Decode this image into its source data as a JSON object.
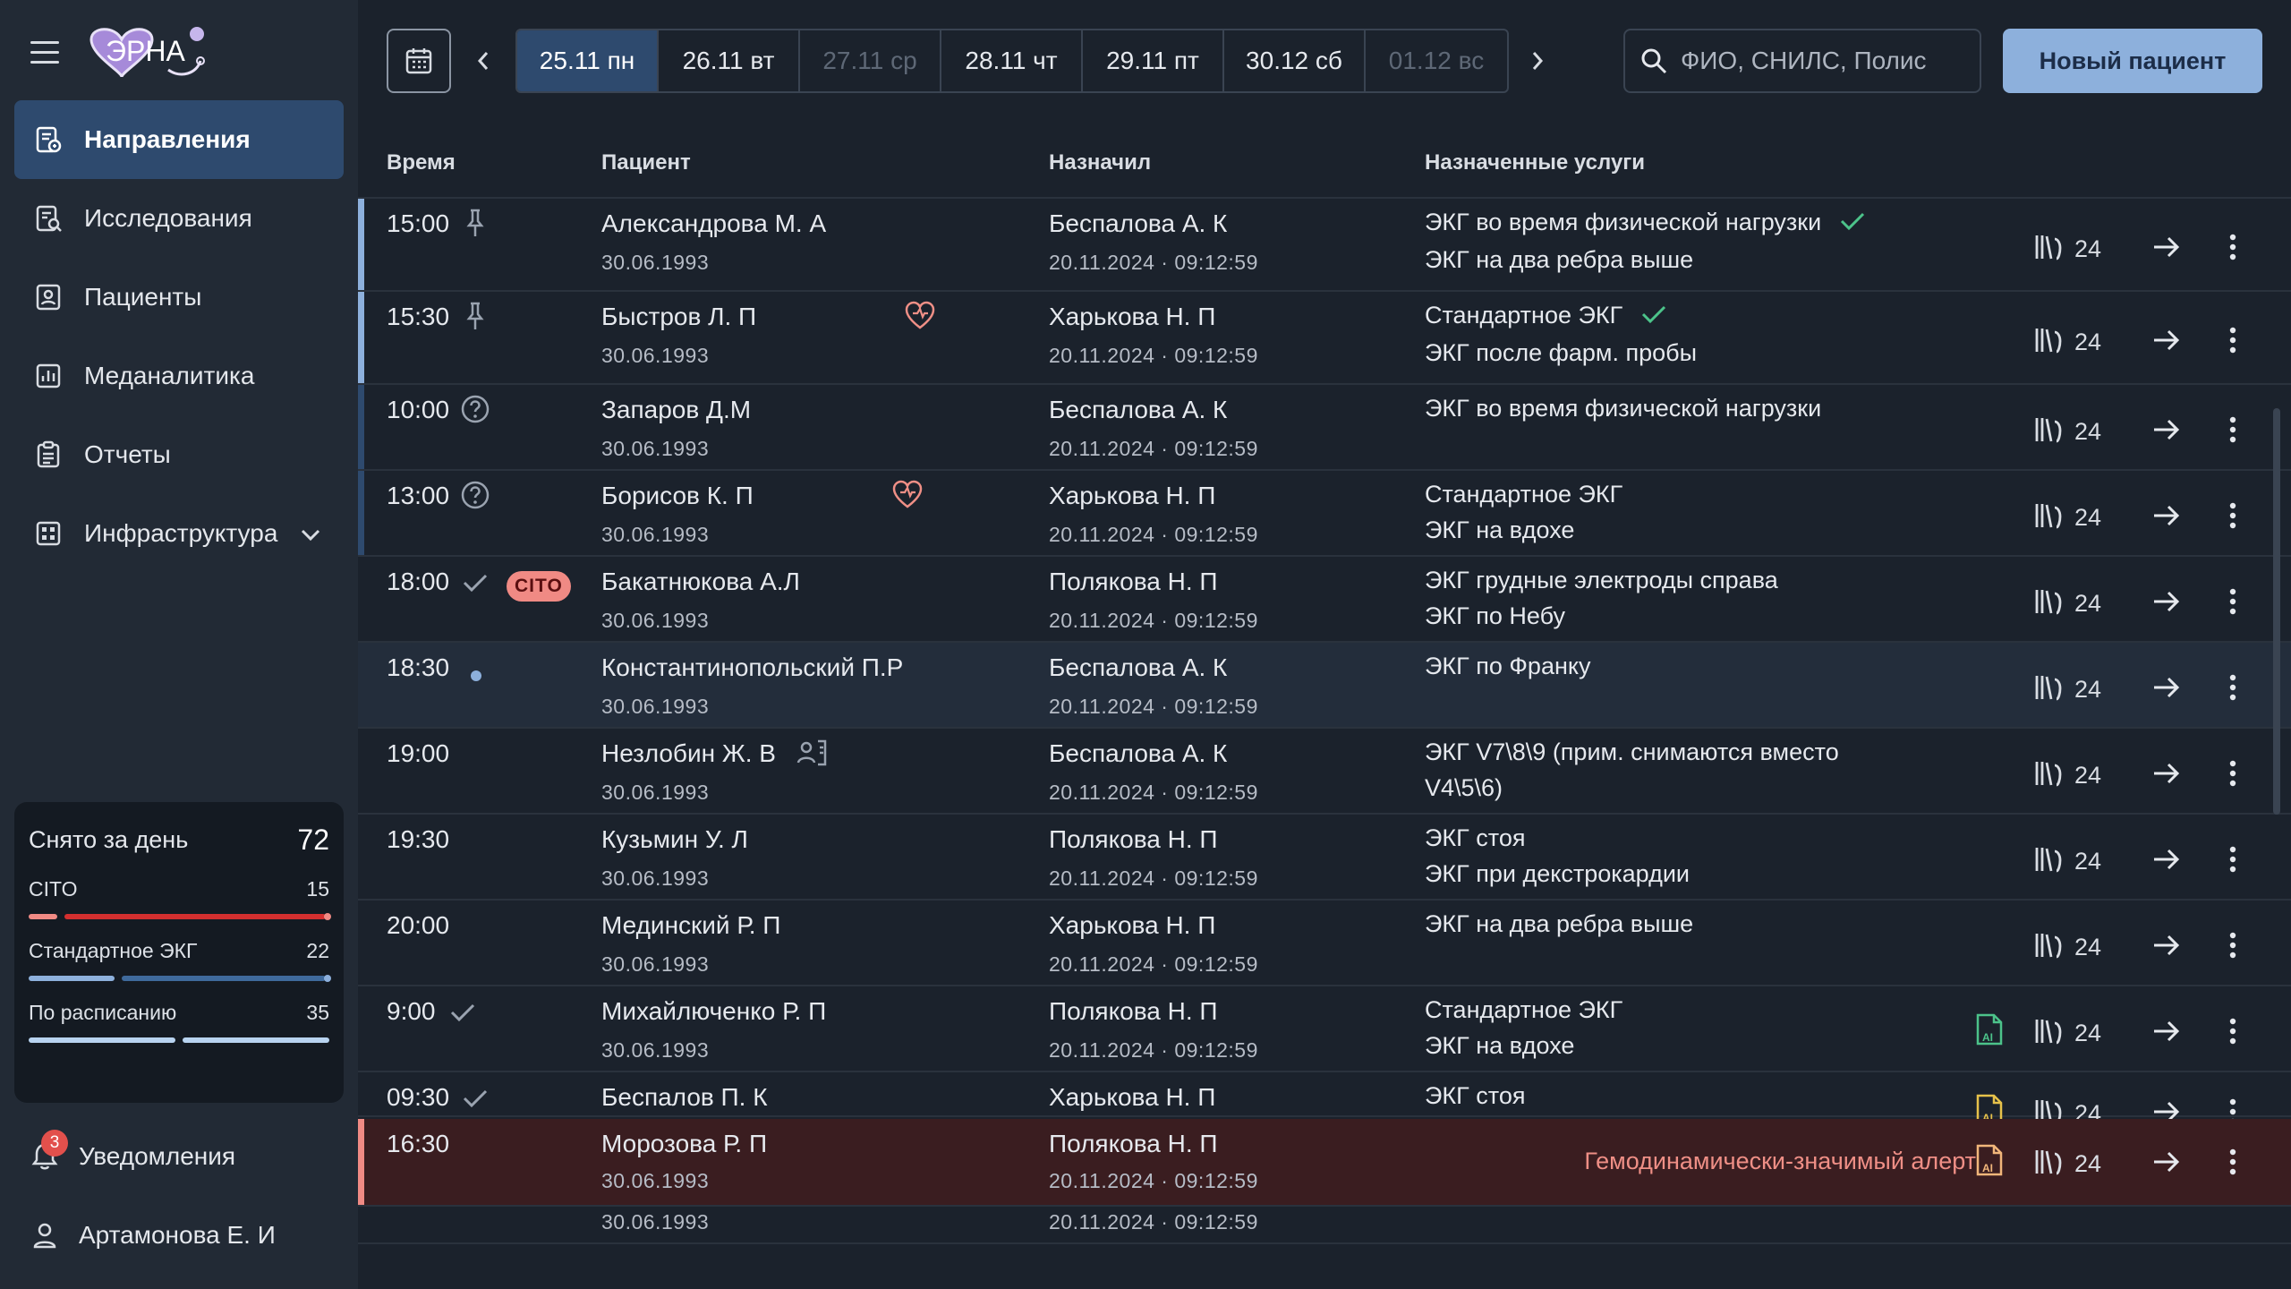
{
  "app": {
    "logo_text": "ЭРНА"
  },
  "nav": [
    {
      "label": "Направления",
      "icon": "referrals-icon",
      "active": true
    },
    {
      "label": "Исследования",
      "icon": "research-icon"
    },
    {
      "label": "Пациенты",
      "icon": "patients-icon"
    },
    {
      "label": "Меданалитика",
      "icon": "analytics-icon"
    },
    {
      "label": "Отчеты",
      "icon": "reports-icon"
    },
    {
      "label": "Инфраструктура",
      "icon": "infrastructure-icon",
      "expandable": true
    }
  ],
  "stats": {
    "title": "Снято за день",
    "total": "72",
    "rows": [
      {
        "label": "CITO",
        "value": "15",
        "color": "#d32f2f"
      },
      {
        "label": "Стандартное ЭКГ",
        "value": "22",
        "color": "#4f7fb5"
      },
      {
        "label": "По расписанию",
        "value": "35",
        "color": "#b8d3f0"
      }
    ]
  },
  "notifications": {
    "label": "Уведомления",
    "count": "3"
  },
  "user": {
    "name": "Артамонова Е. И"
  },
  "dates": [
    {
      "label": "25.11 пн",
      "state": "active"
    },
    {
      "label": "26.11 вт",
      "state": "normal"
    },
    {
      "label": "27.11 ср",
      "state": "disabled"
    },
    {
      "label": "28.11 чт",
      "state": "normal"
    },
    {
      "label": "29.11 пт",
      "state": "normal"
    },
    {
      "label": "30.12 сб",
      "state": "normal"
    },
    {
      "label": "01.12 вс",
      "state": "disabled"
    }
  ],
  "search": {
    "placeholder": "ФИО, СНИЛС, Полис"
  },
  "new_patient_label": "Новый пациент",
  "columns": {
    "time": "Время",
    "patient": "Пациент",
    "assigned_by": "Назначил",
    "services": "Назначенные услуги"
  },
  "colors": {
    "accent_blue": "#2e4a6e",
    "alert_bg": "#3a1d20",
    "alert_text": "#ef8f86",
    "check_green": "#4cc38a"
  },
  "rows": [
    {
      "time": "15:00",
      "status": "pin",
      "patient": "Александрова М. А",
      "dob": "30.06.1993",
      "doctor": "Беспалова А. К",
      "datetime": "20.11.2024 · 09:12:59",
      "services": [
        {
          "t": "ЭКГ во время физической нагрузки",
          "check": true
        },
        {
          "t": "ЭКГ на два ребра выше"
        }
      ],
      "count": "24",
      "accent": "#8db0dc"
    },
    {
      "time": "15:30",
      "status": "pin",
      "patient": "Быстров Л. П",
      "patient_icon": "heart-icon",
      "dob": "30.06.1993",
      "doctor": "Харькова Н. П",
      "datetime": "20.11.2024 · 09:12:59",
      "services": [
        {
          "t": "Стандартное ЭКГ",
          "check": true
        },
        {
          "t": "ЭКГ после фарм. пробы"
        }
      ],
      "count": "24",
      "accent": "#8db0dc"
    },
    {
      "time": "10:00",
      "status": "question",
      "patient": "Запаров Д.М",
      "dob": "30.06.1993",
      "doctor": "Беспалова А. К",
      "datetime": "20.11.2024 · 09:12:59",
      "services": [
        {
          "t": "ЭКГ во время физической нагрузки"
        }
      ],
      "count": "24",
      "accent": "#2e4a6e"
    },
    {
      "time": "13:00",
      "status": "question",
      "patient": "Борисов К. П",
      "patient_icon": "heart-icon",
      "dob": "30.06.1993",
      "doctor": "Харькова Н. П",
      "datetime": "20.11.2024 · 09:12:59",
      "services": [
        {
          "t": "Стандартное ЭКГ"
        },
        {
          "t": "ЭКГ на вдохе"
        }
      ],
      "count": "24",
      "accent": "#2e4a6e"
    },
    {
      "time": "18:00",
      "status": "check",
      "cito": "CITO",
      "patient": "Бакатнюкова А.Л",
      "dob": "30.06.1993",
      "doctor": "Полякова Н. П",
      "datetime": "20.11.2024 · 09:12:59",
      "services": [
        {
          "t": "ЭКГ грудные электроды справа"
        },
        {
          "t": "ЭКГ по Небу"
        }
      ],
      "count": "24"
    },
    {
      "time": "18:30",
      "status": "dot",
      "patient": "Константинопольский П.Р",
      "dob": "30.06.1993",
      "doctor": "Беспалова А. К",
      "datetime": "20.11.2024 · 09:12:59",
      "services": [
        {
          "t": "ЭКГ по Франку"
        }
      ],
      "count": "24",
      "selected": true
    },
    {
      "time": "19:00",
      "status": "",
      "patient": "Незлобин Ж. В",
      "patient_icon": "person-card-icon",
      "dob": "30.06.1993",
      "doctor": "Беспалова А. К",
      "datetime": "20.11.2024 · 09:12:59",
      "services": [
        {
          "t": "ЭКГ V7\\8\\9 (прим. снимаются вместо"
        },
        {
          "t": "V4\\5\\6)"
        }
      ],
      "count": "24"
    },
    {
      "time": "19:30",
      "status": "",
      "patient": "Кузьмин У. Л",
      "dob": "30.06.1993",
      "doctor": "Полякова Н. П",
      "datetime": "20.11.2024 · 09:12:59",
      "services": [
        {
          "t": "ЭКГ стоя"
        },
        {
          "t": "ЭКГ при декстрокардии"
        }
      ],
      "count": "24"
    },
    {
      "time": "20:00",
      "status": "",
      "patient": "Мединский Р. П",
      "dob": "30.06.1993",
      "doctor": "Харькова Н. П",
      "datetime": "20.11.2024 · 09:12:59",
      "services": [
        {
          "t": "ЭКГ на два ребра выше"
        }
      ],
      "count": "24"
    },
    {
      "time": "9:00",
      "status": "check",
      "patient": "Михайлюченко Р. П",
      "dob": "30.06.1993",
      "doctor": "Полякова Н. П",
      "datetime": "20.11.2024 · 09:12:59",
      "services": [
        {
          "t": "Стандартное ЭКГ"
        },
        {
          "t": "ЭКГ на вдохе"
        }
      ],
      "count": "24",
      "ai": "green"
    },
    {
      "time": "09:30",
      "status": "check",
      "patient": "Беспалов П. К",
      "dob": "30.06.1993",
      "doctor": "Харькова Н. П",
      "datetime": "20.11.2024 · 09:12:59",
      "services": [
        {
          "t": "ЭКГ стоя"
        }
      ],
      "count": "24",
      "ai": "yellow"
    }
  ],
  "alert_row": {
    "time": "16:30",
    "patient": "Морозова Р. П",
    "dob": "30.06.1993",
    "doctor": "Полякова Н. П",
    "datetime": "20.11.2024 · 09:12:59",
    "alert_text": "Гемодинамически-значимый алерт",
    "count": "24"
  }
}
